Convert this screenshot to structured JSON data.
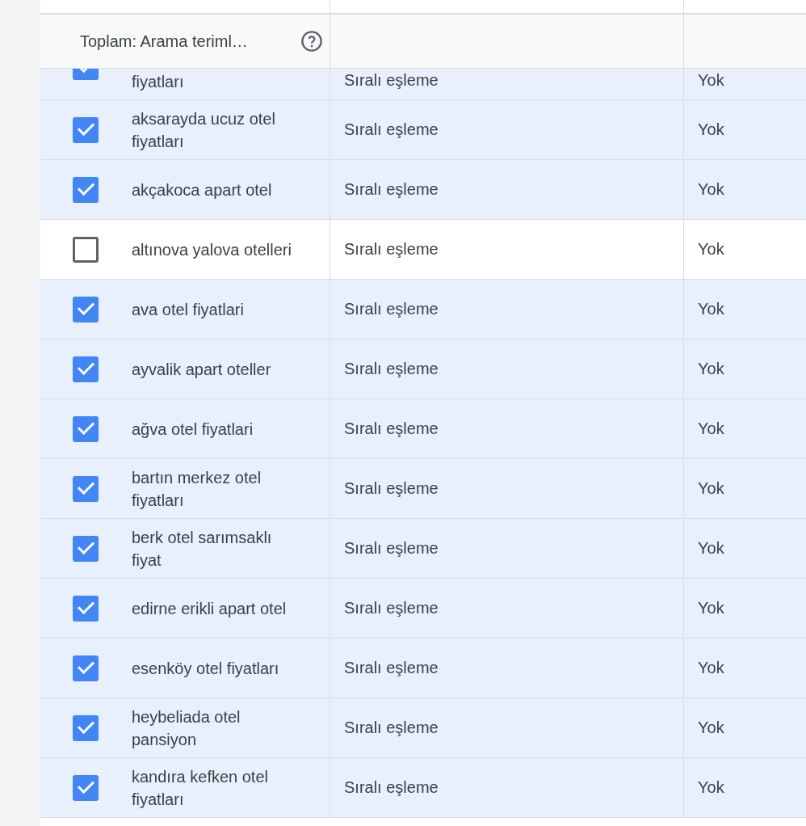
{
  "header": {
    "label": "Toplam: Arama teriml…"
  },
  "rows": [
    {
      "term": "fiyatları",
      "match": "Sıralı eşleme",
      "status": "Yok",
      "checked": true
    },
    {
      "term": "aksarayda ucuz otel fiyatları",
      "match": "Sıralı eşleme",
      "status": "Yok",
      "checked": true
    },
    {
      "term": "akçakoca apart otel",
      "match": "Sıralı eşleme",
      "status": "Yok",
      "checked": true
    },
    {
      "term": "altınova yalova otelleri",
      "match": "Sıralı eşleme",
      "status": "Yok",
      "checked": false
    },
    {
      "term": "ava otel fiyatlari",
      "match": "Sıralı eşleme",
      "status": "Yok",
      "checked": true
    },
    {
      "term": "ayvalik apart oteller",
      "match": "Sıralı eşleme",
      "status": "Yok",
      "checked": true
    },
    {
      "term": "ağva otel fiyatlari",
      "match": "Sıralı eşleme",
      "status": "Yok",
      "checked": true
    },
    {
      "term": "bartın merkez otel fiyatları",
      "match": "Sıralı eşleme",
      "status": "Yok",
      "checked": true
    },
    {
      "term": "berk otel sarımsaklı fiyat",
      "match": "Sıralı eşleme",
      "status": "Yok",
      "checked": true
    },
    {
      "term": "edirne erikli apart otel",
      "match": "Sıralı eşleme",
      "status": "Yok",
      "checked": true
    },
    {
      "term": "esenköy otel fiyatları",
      "match": "Sıralı eşleme",
      "status": "Yok",
      "checked": true
    },
    {
      "term": "heybeliada otel pansiyon",
      "match": "Sıralı eşleme",
      "status": "Yok",
      "checked": true
    },
    {
      "term": "kandıra kefken otel fiyatları",
      "match": "Sıralı eşleme",
      "status": "Yok",
      "checked": true
    }
  ]
}
